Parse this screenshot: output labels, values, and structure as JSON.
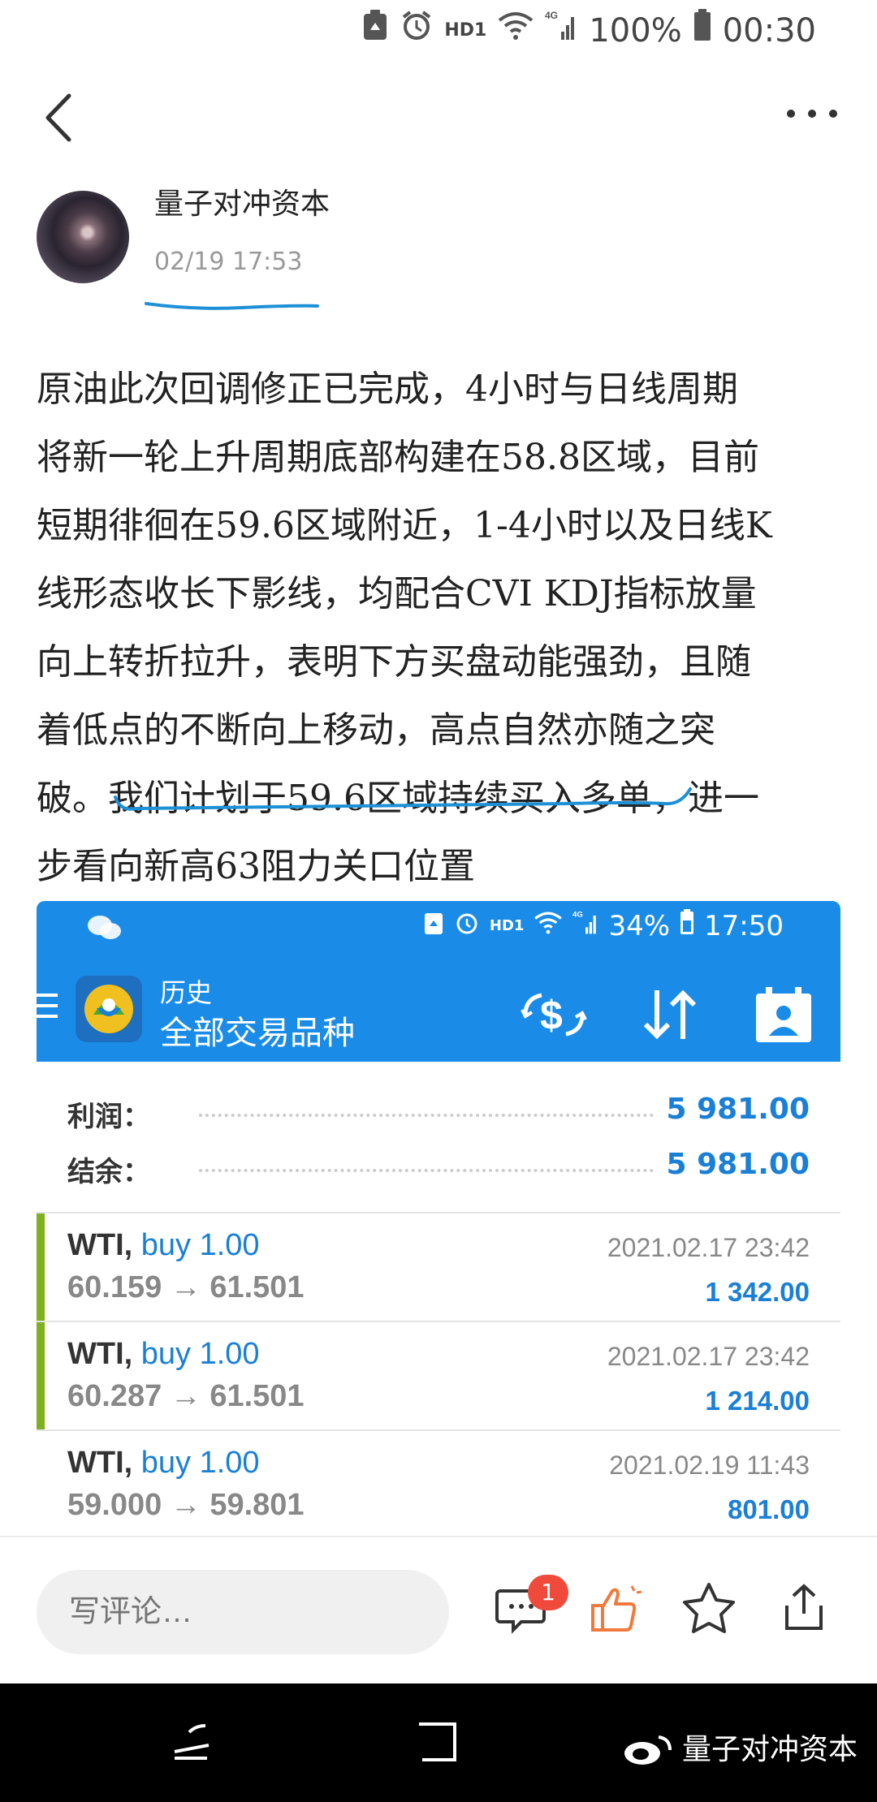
{
  "status_bar": {
    "network": "HD1",
    "signal": "4G",
    "battery": "100%",
    "time": "00:30"
  },
  "post": {
    "author": "量子对冲资本",
    "time": "02/19 17:53",
    "body_lines": [
      "原油此次回调修正已完成，4小时与日线周期",
      "将新一轮上升周期底部构建在58.8区域，目前",
      "短期徘徊在59.6区域附近，1-4小时以及日线K",
      "线形态收长下影线，均配合CVI KDJ指标放量",
      "向上转折拉升，表明下方买盘动能强劲，且随",
      "着低点的不断向上移动，高点自然亦随之突",
      "破。我们计划于59.6区域持续买入多单，进一",
      "步看向新高63阻力关口位置"
    ]
  },
  "embedded": {
    "status": {
      "network": "HD1",
      "signal": "4G",
      "battery": "34%",
      "time": "17:50"
    },
    "header": {
      "subtitle": "历史",
      "title": "全部交易品种"
    },
    "summary": [
      {
        "label": "利润：",
        "value": "5 981.00"
      },
      {
        "label": "结余：",
        "value": "5 981.00"
      }
    ],
    "trades": [
      {
        "symbol": "WTI,",
        "direction": "buy 1.00",
        "prices": "60.159 → 61.501",
        "datetime": "2021.02.17 23:42",
        "profit": "1 342.00"
      },
      {
        "symbol": "WTI,",
        "direction": "buy 1.00",
        "prices": "60.287 → 61.501",
        "datetime": "2021.02.17 23:42",
        "profit": "1 214.00"
      },
      {
        "symbol": "WTI,",
        "direction": "buy 1.00",
        "prices": "59.000 → 59.801",
        "datetime": "2021.02.19 11:43",
        "profit": "801.00"
      }
    ]
  },
  "actions": {
    "comment_placeholder": "写评论…",
    "comment_count": "1"
  },
  "watermark": "量子对冲资本",
  "colors": {
    "accent": "#1a8ce8",
    "profit": "#1a7fd6",
    "trade_bar": "#7fb020",
    "badge": "#f04a3c",
    "annotation": "#1e90d6"
  }
}
